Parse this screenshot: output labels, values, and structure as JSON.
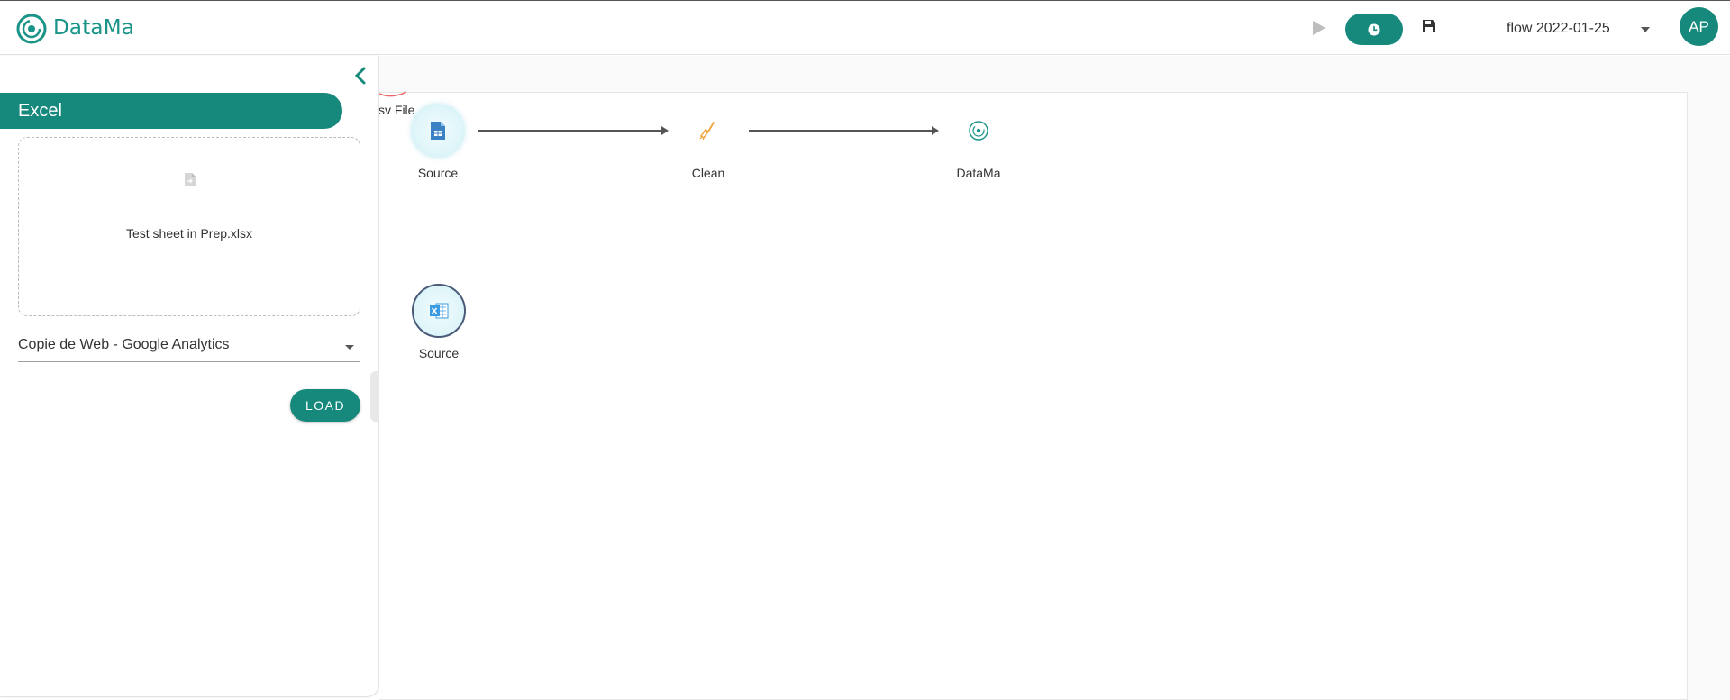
{
  "app": {
    "brand": "DataMa"
  },
  "header": {
    "flow_name": "flow 2022-01-25",
    "avatar_initials": "AP"
  },
  "sidebar": {
    "section_title": "Excel",
    "dropzone_file": "Test sheet in Prep.xlsx",
    "sheet_selected": "Copie de Web - Google Analytics",
    "load_label": "LOAD"
  },
  "canvas": {
    "partial_node_label": "sv File",
    "nodes": [
      {
        "label": "Source",
        "icon": "document-icon"
      },
      {
        "label": "Clean",
        "icon": "broom-icon"
      },
      {
        "label": "DataMa",
        "icon": "datama-icon"
      },
      {
        "label": "Source",
        "icon": "excel-icon"
      }
    ]
  },
  "colors": {
    "accent": "#16897c",
    "excel_blue": "#3b9be0",
    "clean_orange": "#f0a33a"
  }
}
